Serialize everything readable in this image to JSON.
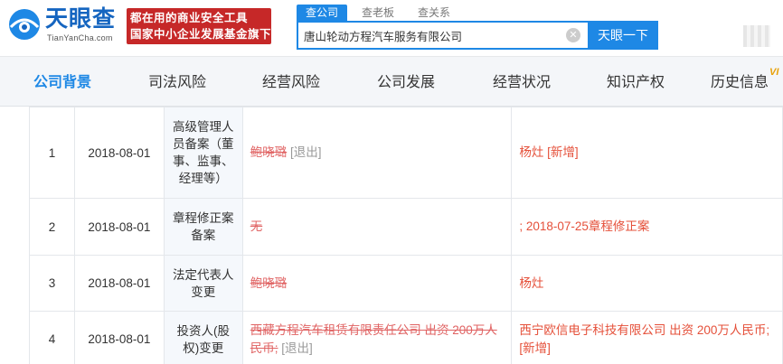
{
  "header": {
    "logo_cn": "天眼查",
    "logo_en": "TianYanCha.com",
    "slogan_line1": "都在用的商业安全工具",
    "slogan_line2": "国家中小企业发展基金旗下",
    "search_tabs": [
      "查公司",
      "查老板",
      "查关系"
    ],
    "search_value": "唐山轮动方程汽车服务有限公司",
    "search_button": "天眼一下"
  },
  "nav": {
    "items": [
      "公司背景",
      "司法风险",
      "经营风险",
      "公司发展",
      "经营状况",
      "知识产权",
      "历史信息"
    ],
    "active_index": 0,
    "vip_label": "VI"
  },
  "records": [
    {
      "index": "1",
      "date": "2018-08-01",
      "type": "高级管理人员备案（董事、监事、经理等）",
      "before": "鲍晓璐",
      "before_note": "[退出]",
      "after": "杨灶 [新增]"
    },
    {
      "index": "2",
      "date": "2018-08-01",
      "type": "章程修正案备案",
      "before": "无",
      "before_note": "",
      "after": "; 2018-07-25章程修正案"
    },
    {
      "index": "3",
      "date": "2018-08-01",
      "type": "法定代表人变更",
      "before": "鲍晓璐",
      "before_note": "",
      "after": "杨灶"
    },
    {
      "index": "4",
      "date": "2018-08-01",
      "type": "投资人(股权)变更",
      "before": "西藏方程汽车租赁有限责任公司 出资 200万人民币;",
      "before_note": "[退出]",
      "after": "西宁欧信电子科技有限公司 出资 200万人民币; [新增]"
    }
  ],
  "colors": {
    "brand_blue": "#1e88e5",
    "slogan_red": "#c62828",
    "change_red": "#e5503a"
  }
}
